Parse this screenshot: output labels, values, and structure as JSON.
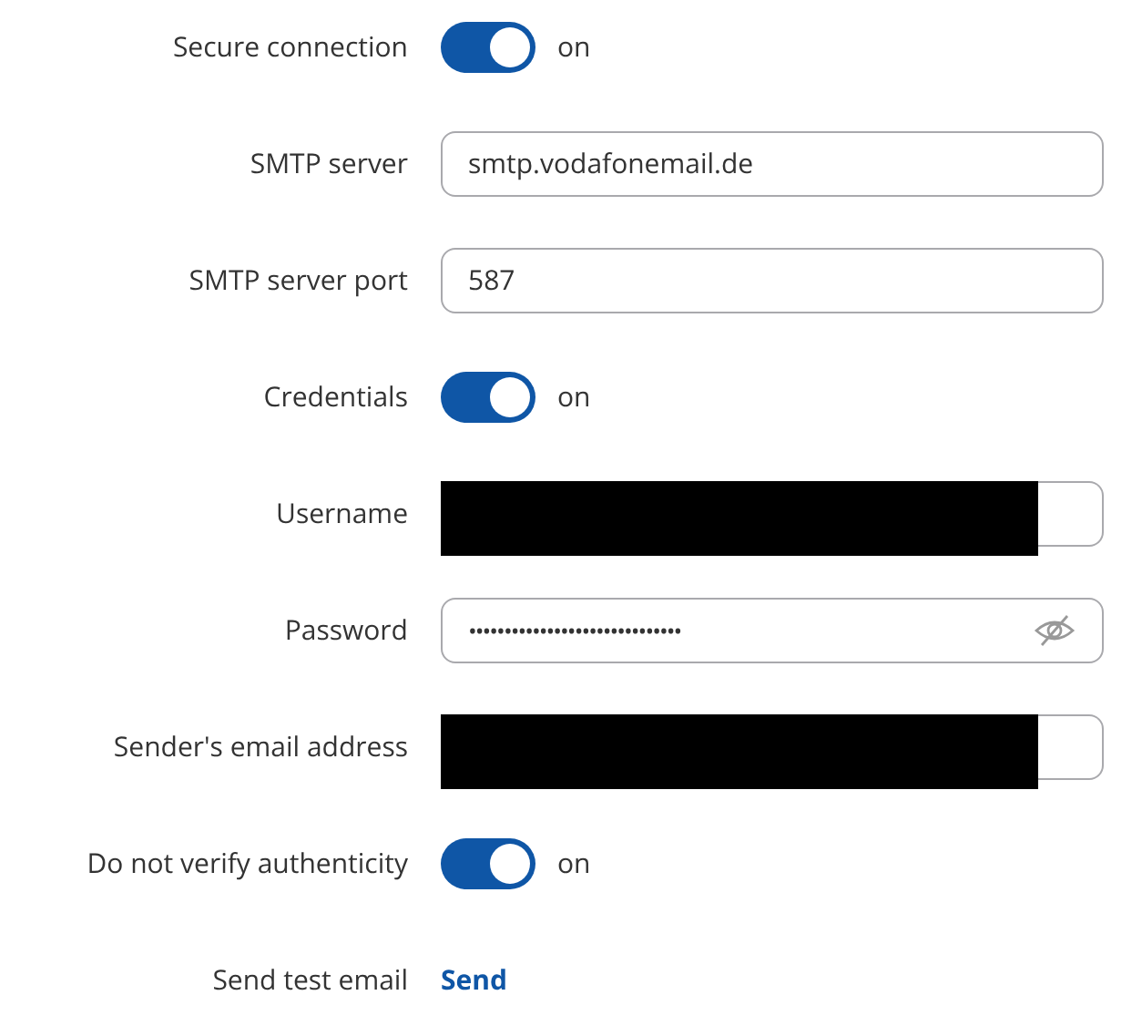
{
  "settings": [
    {
      "kind": "toggle",
      "label": "Secure connection",
      "on": true,
      "state_text": "on"
    },
    {
      "kind": "text",
      "label": "SMTP server",
      "value": "smtp.vodafonemail.de"
    },
    {
      "kind": "text",
      "label": "SMTP server port",
      "value": "587"
    },
    {
      "kind": "toggle",
      "label": "Credentials",
      "on": true,
      "state_text": "on"
    },
    {
      "kind": "text",
      "label": "Username",
      "redacted": true
    },
    {
      "kind": "password",
      "label": "Password",
      "value": "••••••••••••••••••••••••••••••"
    },
    {
      "kind": "text",
      "label": "Sender's email address",
      "redacted": true
    },
    {
      "kind": "toggle",
      "label": "Do not verify authenticity",
      "on": true,
      "state_text": "on"
    },
    {
      "kind": "link",
      "label": "Send test email",
      "link_text": "Send"
    }
  ]
}
